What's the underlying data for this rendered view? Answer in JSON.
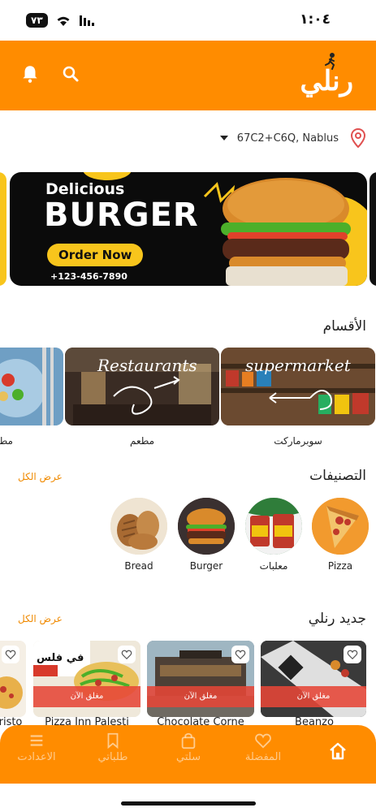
{
  "status_bar": {
    "time": "١:٠٤",
    "battery": "٧٣"
  },
  "header": {
    "logo_text": "رنلي",
    "icons": [
      "bell-icon",
      "search-icon"
    ]
  },
  "location": {
    "address": "67C2+C6Q, Nablus",
    "icon": "map-pin-icon"
  },
  "banner": {
    "small_text": "Delicious",
    "big_text": "BURGER",
    "cta": "Order Now",
    "phone": "+123-456-7890"
  },
  "departments": {
    "title": "الأقسام",
    "items": [
      {
        "name": "سوبرماركت",
        "image_text": "supermarket"
      },
      {
        "name": "مطعم",
        "image_text": "Restaurants"
      },
      {
        "name": "مطا",
        "image_text": ""
      }
    ]
  },
  "categories": {
    "title": "التصنيفات",
    "see_all": "عرض الكل",
    "items": [
      {
        "name": "Pizza"
      },
      {
        "name": "معلبات"
      },
      {
        "name": "Burger"
      },
      {
        "name": "Bread"
      }
    ]
  },
  "new_restaurants": {
    "title": "جديد رنلي",
    "see_all": "عرض الكل",
    "items": [
      {
        "name": "Beanzo",
        "status": "مغلق الآن"
      },
      {
        "name": "Chocolate Corne",
        "status": "مغلق الآن"
      },
      {
        "name": "Pizza Inn Palesti",
        "status": "مغلق الآن",
        "sign_text": "في فلس"
      },
      {
        "name": "risto",
        "status": ""
      }
    ]
  },
  "bottom_nav": {
    "items": [
      {
        "label": "",
        "icon": "home-icon"
      },
      {
        "label": "المفضلة",
        "icon": "heart-icon"
      },
      {
        "label": "سلتي",
        "icon": "bag-icon"
      },
      {
        "label": "طلباتي",
        "icon": "bookmark-icon"
      },
      {
        "label": "الاعدادت",
        "icon": "menu-icon"
      }
    ]
  },
  "colors": {
    "brand": "#ff8c00",
    "accent_text": "#f08a00",
    "banner_yellow": "#f8c51c",
    "closed_red": "#e64637"
  }
}
